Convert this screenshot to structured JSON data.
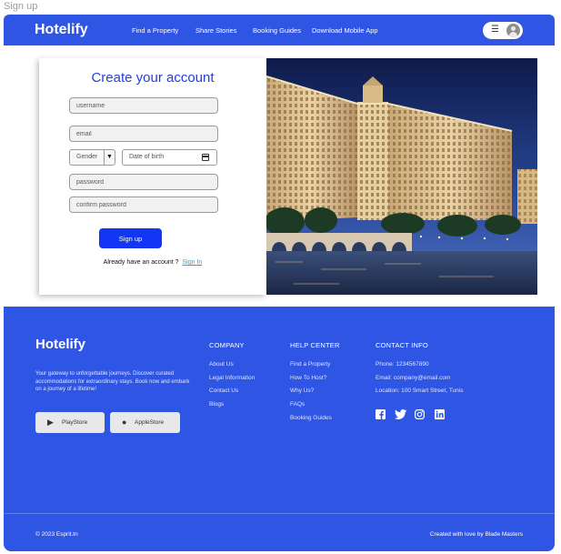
{
  "page_label": "Sign up",
  "header": {
    "brand": "Hotelify",
    "nav": [
      "Find a Property",
      "Share Stories",
      "Booking Guides",
      "Download Mobile App"
    ]
  },
  "form": {
    "title": "Create your account",
    "username_placeholder": "username",
    "email_placeholder": "email",
    "gender_label": "Gender",
    "dob_label": "Date of birth",
    "password_placeholder": "password",
    "confirm_placeholder": "confirm password",
    "signup_button": "Sign up",
    "already_text": "Already have an account ?",
    "signin_link": "Sign In"
  },
  "footer": {
    "brand": "Hotelify",
    "tagline": "Your gateway to unforgettable journeys. Discover curated accommodations for extraordinary stays. Book now and embark on a journey of a lifetime!",
    "playstore": "PlayStore",
    "appstore": "AppleStore",
    "company_title": "COMPANY",
    "company_links": [
      "About Us",
      "Legal Information",
      "Contact Us",
      "Blogs"
    ],
    "help_title": "HELP CENTER",
    "help_links": [
      "Find a Property",
      "How To Host?",
      "Why Us?",
      "FAQs",
      "Booking Guides"
    ],
    "contact_title": "CONTACT INFO",
    "contact_lines": [
      "Phone: 1234567890",
      "Email: company@email.com",
      "Location: 100 Smart Street, Tunis"
    ],
    "social_icons": [
      "facebook-icon",
      "twitter-icon",
      "instagram-icon",
      "linkedin-icon"
    ],
    "copyright": "© 2023 Esprit.tn",
    "credits": "Created with love by Blade Masters"
  },
  "colors": {
    "brand_blue": "#2f55e4",
    "button_blue": "#1137f5",
    "title_blue": "#2340d8",
    "link_cyan": "#19a8e6"
  }
}
